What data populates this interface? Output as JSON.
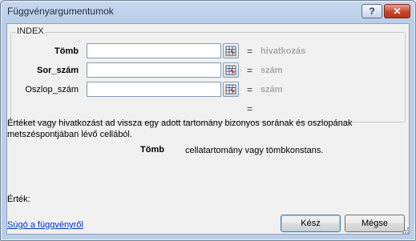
{
  "window": {
    "title": "Függvényargumentumok",
    "help_button": "?",
    "close_button": "✕"
  },
  "function_group": {
    "name": "INDEX",
    "args": [
      {
        "label": "Tömb",
        "value": "",
        "result": "hivatkozás"
      },
      {
        "label": "Sor_szám",
        "value": "",
        "result": "szám"
      },
      {
        "label": "Oszlop_szám",
        "value": "",
        "result": "szám"
      }
    ],
    "equals": "="
  },
  "overall_result": "=",
  "description": "Értéket vagy hivatkozást ad vissza egy adott tartomány bizonyos sorának és oszlopának metszéspontjában lévő cellából.",
  "arg_description": {
    "name": "Tömb",
    "text": "cellatartomány vagy tömbkonstans."
  },
  "result_label": "Érték:",
  "help_link": "Súgó a függvényről",
  "buttons": {
    "ok": "Kész",
    "cancel": "Mégse"
  }
}
